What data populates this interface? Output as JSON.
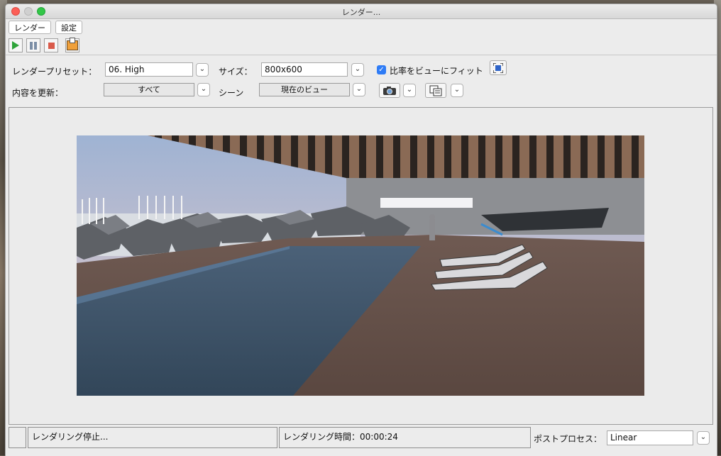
{
  "window": {
    "title": "レンダー..."
  },
  "menu": {
    "render_label": "レンダー",
    "settings_label": "設定"
  },
  "toolbar": {
    "start_icon": "play-icon",
    "pause_icon": "pause-icon",
    "stop_icon": "stop-icon",
    "export_icon": "export-image-icon"
  },
  "settings": {
    "preset_label": "レンダープリセット：",
    "preset_value": "06. High",
    "size_label": "サイズ：",
    "size_value": "800x600",
    "fit_label": "比率をビューにフィット",
    "fit_checked": true,
    "update_label": "内容を更新：",
    "update_value": "すべて",
    "scene_label": "シーン",
    "scene_value": "現在のビュー"
  },
  "status": {
    "message": "レンダリング停止...",
    "time_label": "レンダリング時間：00:00:24",
    "postprocess_label": "ポストプロセス：",
    "postprocess_value": "Linear"
  },
  "colors": {
    "accent": "#2f7cf6",
    "play": "#2ea43a",
    "stop": "#d95a4a"
  }
}
